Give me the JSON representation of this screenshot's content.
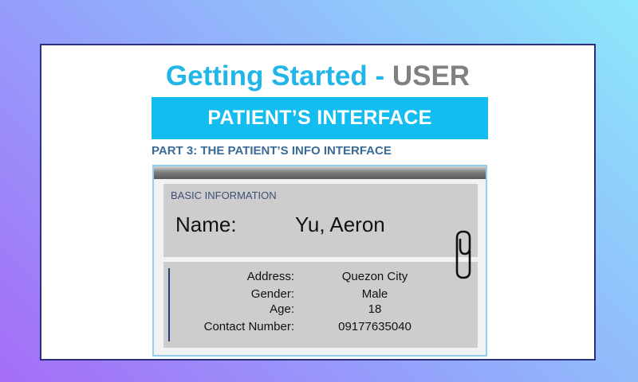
{
  "heading": {
    "part1": "Getting Started",
    "sep": " - ",
    "part2": "USER"
  },
  "banner": "PATIENT’S INTERFACE",
  "part_label": "PART 3: THE PATIENT’S INFO INTERFACE",
  "basic": {
    "title": "BASIC INFORMATION",
    "name_label": "Name:",
    "name_value": "Yu, Aeron"
  },
  "details": [
    {
      "label": "Address:",
      "value": "Quezon City"
    },
    {
      "label": "Gender:",
      "value": "Male"
    },
    {
      "label": "Age:",
      "value": "18"
    },
    {
      "label": "Contact Number:",
      "value": "09177635040"
    }
  ],
  "icons": {
    "attachment": "paperclip-icon"
  },
  "colors": {
    "heading": "#22b6e8",
    "heading_user": "#808080",
    "banner": "#13bdf0",
    "part_label": "#3a6b95",
    "panel": "#cdcdcd"
  }
}
